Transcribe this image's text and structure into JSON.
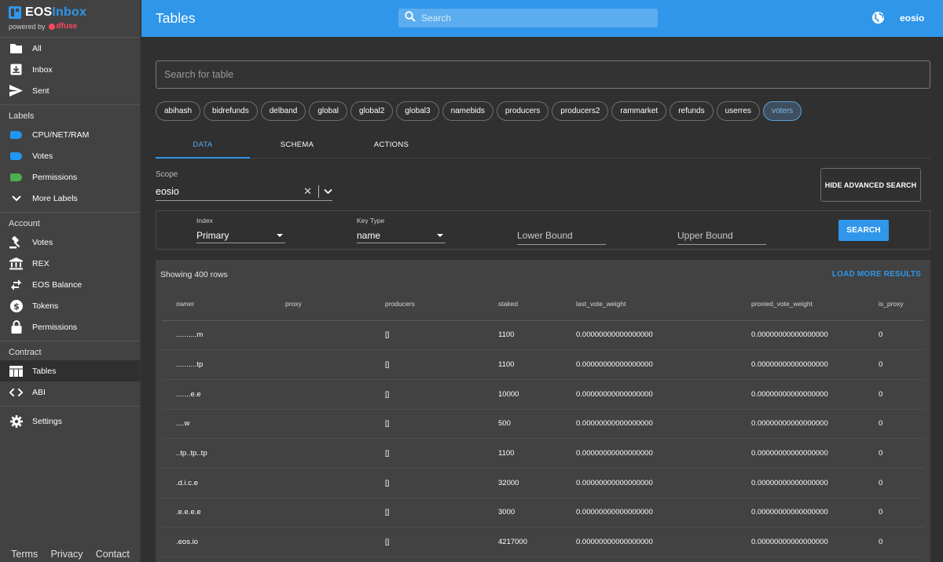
{
  "app": {
    "name_part1": "EOS",
    "name_part2": "Inbox",
    "powered_by": "powered by",
    "powered_brand": "dfuse"
  },
  "sidebar": {
    "mail": [
      {
        "label": "All",
        "icon": "folder-icon"
      },
      {
        "label": "Inbox",
        "icon": "inbox-icon"
      },
      {
        "label": "Sent",
        "icon": "send-icon"
      }
    ],
    "labels_title": "Labels",
    "labels": [
      {
        "label": "CPU/NET/RAM",
        "color": "#2196f3"
      },
      {
        "label": "Votes",
        "color": "#2196f3"
      },
      {
        "label": "Permissions",
        "color": "#4caf50"
      }
    ],
    "more_labels": "More Labels",
    "account_title": "Account",
    "account": [
      {
        "label": "Votes",
        "icon": "gavel-icon"
      },
      {
        "label": "REX",
        "icon": "bank-icon"
      },
      {
        "label": "EOS Balance",
        "icon": "transfer-icon"
      },
      {
        "label": "Tokens",
        "icon": "dollar-icon"
      },
      {
        "label": "Permissions",
        "icon": "lock-icon"
      }
    ],
    "contract_title": "Contract",
    "contract": [
      {
        "label": "Tables",
        "icon": "table-icon",
        "active": true
      },
      {
        "label": "ABI",
        "icon": "code-icon"
      }
    ],
    "settings": "Settings",
    "footer": [
      "Terms",
      "Privacy",
      "Contact"
    ]
  },
  "header": {
    "title": "Tables",
    "search_placeholder": "Search",
    "user": "eosio"
  },
  "table_search_placeholder": "Search for table",
  "tables": [
    "abihash",
    "bidrefunds",
    "delband",
    "global",
    "global2",
    "global3",
    "namebids",
    "producers",
    "producers2",
    "rammarket",
    "refunds",
    "userres",
    "voters"
  ],
  "selected_table": "voters",
  "tabs": [
    "DATA",
    "SCHEMA",
    "ACTIONS"
  ],
  "active_tab": "DATA",
  "scope": {
    "label": "Scope",
    "value": "eosio"
  },
  "hide_advanced": "HIDE ADVANCED SEARCH",
  "advanced": {
    "index_label": "Index",
    "index_value": "Primary",
    "key_type_label": "Key Type",
    "key_type_value": "name",
    "lower_bound_placeholder": "Lower Bound",
    "upper_bound_placeholder": "Upper Bound",
    "search_button": "SEARCH"
  },
  "results": {
    "showing": "Showing 400 rows",
    "load_more": "LOAD MORE RESULTS",
    "columns": [
      "owner",
      "proxy",
      "producers",
      "staked",
      "last_vote_weight",
      "proxied_vote_weight",
      "is_proxy"
    ],
    "rows": [
      [
        "..........m",
        "",
        "[]",
        "1100",
        "0.00000000000000000",
        "0.00000000000000000",
        "0"
      ],
      [
        "..........tp",
        "",
        "[]",
        "1100",
        "0.00000000000000000",
        "0.00000000000000000",
        "0"
      ],
      [
        ".......e.e",
        "",
        "[]",
        "10000",
        "0.00000000000000000",
        "0.00000000000000000",
        "0"
      ],
      [
        "....w",
        "",
        "[]",
        "500",
        "0.00000000000000000",
        "0.00000000000000000",
        "0"
      ],
      [
        "..tp..tp..tp",
        "",
        "[]",
        "1100",
        "0.00000000000000000",
        "0.00000000000000000",
        "0"
      ],
      [
        ".d.i.c.e",
        "",
        "[]",
        "32000",
        "0.00000000000000000",
        "0.00000000000000000",
        "0"
      ],
      [
        ".e.e.e.e",
        "",
        "[]",
        "3000",
        "0.00000000000000000",
        "0.00000000000000000",
        "0"
      ],
      [
        ".eos.io",
        "",
        "[]",
        "4217000",
        "0.00000000000000000",
        "0.00000000000000000",
        "0"
      ]
    ]
  }
}
